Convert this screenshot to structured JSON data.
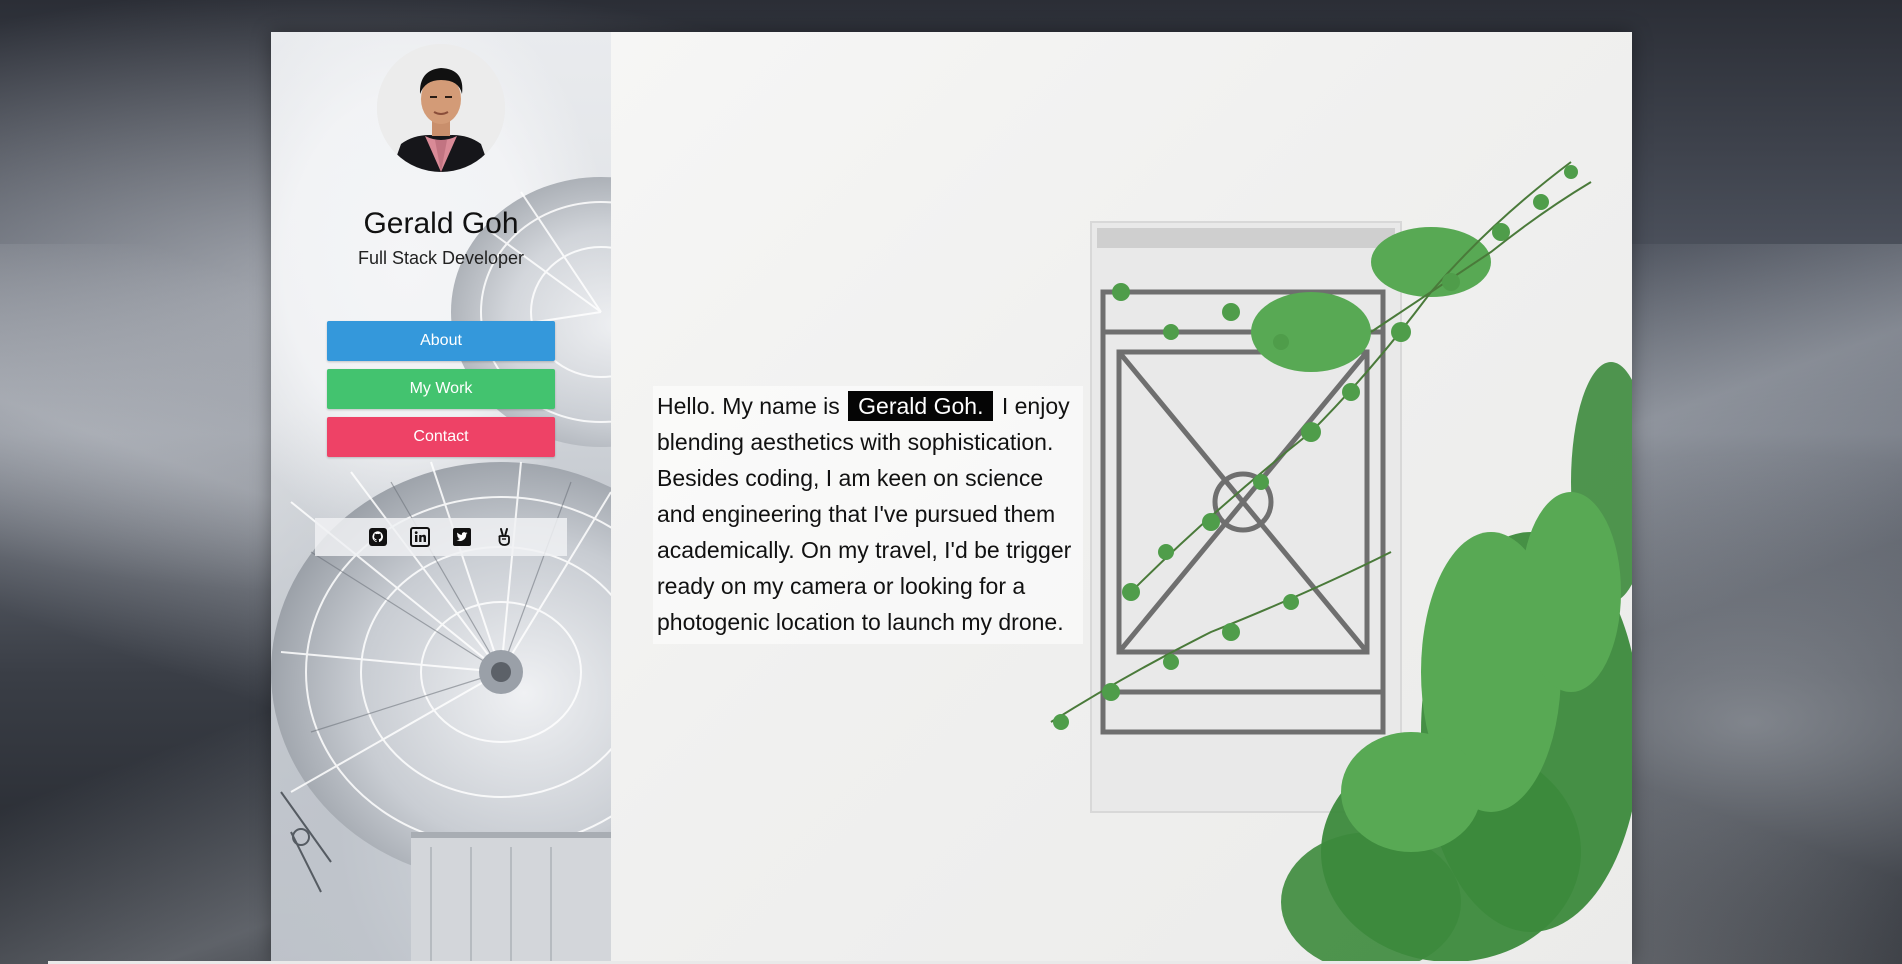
{
  "profile": {
    "name": "Gerald Goh",
    "role": "Full Stack Developer"
  },
  "nav": {
    "buttons": [
      {
        "label": "About",
        "color": "#3498db"
      },
      {
        "label": "My Work",
        "color": "#43c36f"
      },
      {
        "label": "Contact",
        "color": "#ee4266"
      }
    ]
  },
  "social": {
    "icons": [
      "github-icon",
      "linkedin-icon",
      "twitter-icon",
      "peace-hand-icon"
    ]
  },
  "intro": {
    "before": "Hello. My name is",
    "highlight": "Gerald Goh.",
    "after": "I enjoy blending aesthetics with sophistication. Besides coding, I am keen on science and engineering that I've pursued them academically. On my travel, I'd be trigger ready on my camera or looking for a photogenic location to launch my drone."
  }
}
